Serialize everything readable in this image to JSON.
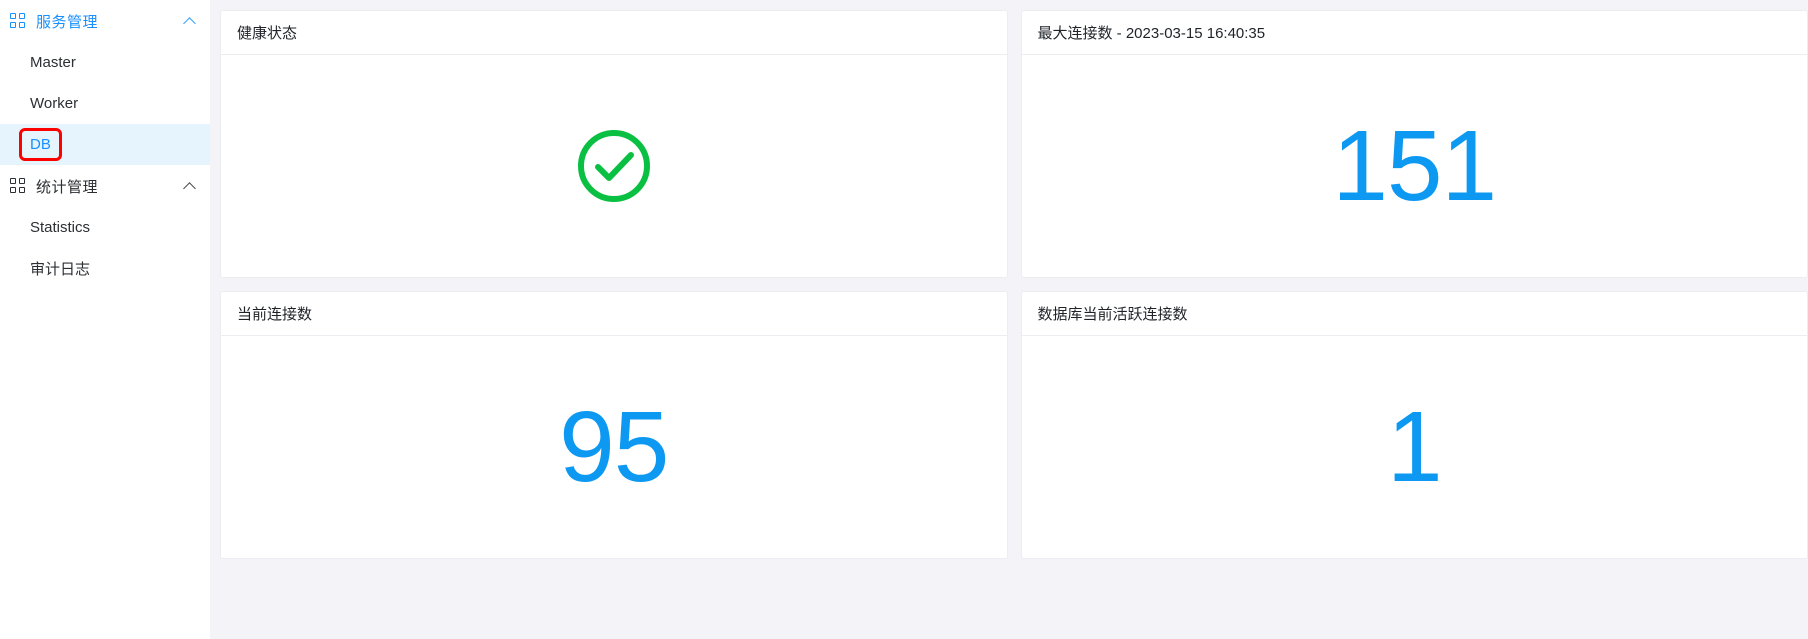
{
  "colors": {
    "accent_blue": "#1890ff",
    "stat_blue": "#0d99f2",
    "health_green": "#0ac043",
    "selected_bg": "#e6f4fd",
    "annotation_red": "#ff0000",
    "main_bg": "#f4f4f8",
    "card_border": "#ebedf0"
  },
  "sidebar": {
    "groups": [
      {
        "label": "服务管理",
        "icon": "grid-icon",
        "caret": "chevron-up-icon",
        "active": true,
        "items": [
          {
            "label": "Master",
            "selected": false
          },
          {
            "label": "Worker",
            "selected": false
          },
          {
            "label": "DB",
            "selected": true
          }
        ]
      },
      {
        "label": "统计管理",
        "icon": "grid-icon",
        "caret": "chevron-up-icon",
        "active": false,
        "items": [
          {
            "label": "Statistics",
            "selected": false
          },
          {
            "label": "审计日志",
            "selected": false
          }
        ]
      }
    ]
  },
  "main": {
    "cards": [
      {
        "title": "健康状态",
        "content_type": "status-icon",
        "icon": "check-circle-icon",
        "value": ""
      },
      {
        "title": "最大连接数 - 2023-03-15 16:40:35",
        "content_type": "number",
        "value": "151"
      },
      {
        "title": "当前连接数",
        "content_type": "number",
        "value": "95"
      },
      {
        "title": "数据库当前活跃连接数",
        "content_type": "number",
        "value": "1"
      }
    ]
  }
}
